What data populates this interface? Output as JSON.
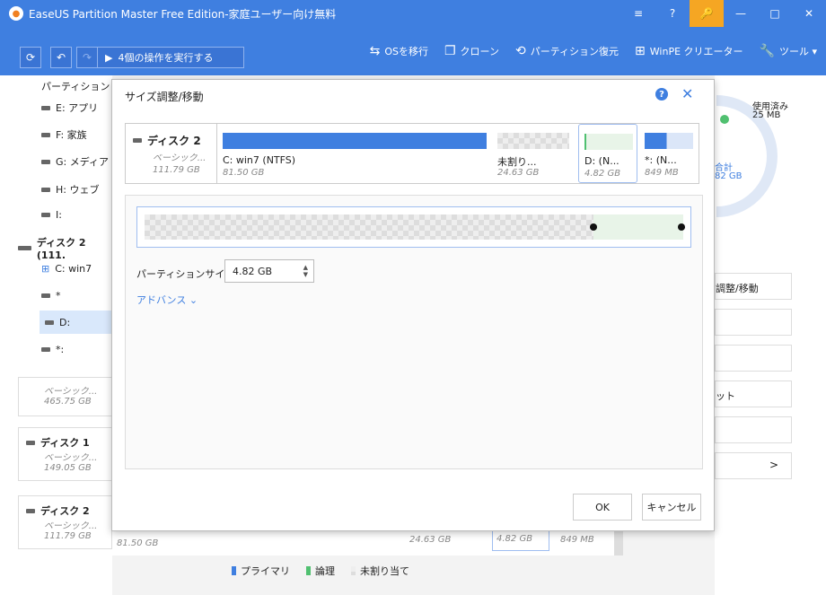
{
  "window": {
    "title": "EaseUS Partition Master Free Edition-家庭ユーザー向け無料",
    "buttons": [
      "≡",
      "?",
      "🔑",
      "—",
      "□",
      "✕"
    ]
  },
  "toolbar": {
    "execute_label": "4個の操作を実行する",
    "tools": [
      {
        "icon": "migrate-os-icon",
        "glyph": "⇆",
        "label": "OSを移行"
      },
      {
        "icon": "clone-icon",
        "glyph": "❐",
        "label": "クローン"
      },
      {
        "icon": "partition-recovery-icon",
        "glyph": "⟲",
        "label": "パーティション復元"
      },
      {
        "icon": "winpe-icon",
        "glyph": "⊞",
        "label": "WinPE クリエーター"
      },
      {
        "icon": "tools-icon",
        "glyph": "🔧",
        "label": "ツール ▾"
      }
    ]
  },
  "left": {
    "header": "パーティション",
    "items": [
      "E: アプリ",
      "F: 家族",
      "G: メディア",
      "H: ウェブ",
      "I:"
    ],
    "disk2_label": "ディスク 2 (111.",
    "disk2_items": [
      "C: win7",
      "*",
      "D:",
      "*:"
    ],
    "cards": [
      {
        "name": "ベーシック...",
        "size": "465.75 GB"
      },
      {
        "name": "ディスク 1",
        "sub": "ベーシック...",
        "size": "149.05 GB"
      },
      {
        "name": "ディスク 2",
        "sub": "ベーシック...",
        "size": "111.79 GB"
      }
    ]
  },
  "right": {
    "used_label": "使用済み",
    "used_value": "25 MB",
    "total_label": "合計",
    "total_value": "82 GB",
    "actions": [
      "調整/移動",
      "",
      "",
      "ット",
      "",
      ">"
    ]
  },
  "bg_disk_row": {
    "c_size": "81.50 GB",
    "unalloc_size": "24.63 GB",
    "d_size": "4.82 GB",
    "star_size": "849 MB",
    "c_name": "C: win7 (NTFS)",
    "d_name": "D: (N..."
  },
  "legend": [
    {
      "label": "プライマリ",
      "color": "#3f7fe0"
    },
    {
      "label": "論理",
      "color": "#50c070"
    },
    {
      "label": "未割り当て",
      "color": "#cccccc"
    }
  ],
  "dialog": {
    "title": "サイズ調整/移動",
    "help": "?",
    "close": "✕",
    "disk": {
      "name": "ディスク 2",
      "type": "ベーシック...",
      "size": "111.79 GB"
    },
    "partitions": [
      {
        "name": "C: win7 (NTFS)",
        "size": "81.50 GB"
      },
      {
        "name": "未割り...",
        "size": "24.63 GB"
      },
      {
        "name": "D: (N...",
        "size": "4.82 GB"
      },
      {
        "name": "*: (N...",
        "size": "849 MB"
      }
    ],
    "partition_size_label": "パーティションサイズ:",
    "partition_size_value": "4.82 GB",
    "advance_label": "アドバンス ⌄",
    "ok_label": "OK",
    "cancel_label": "キャンセル"
  }
}
